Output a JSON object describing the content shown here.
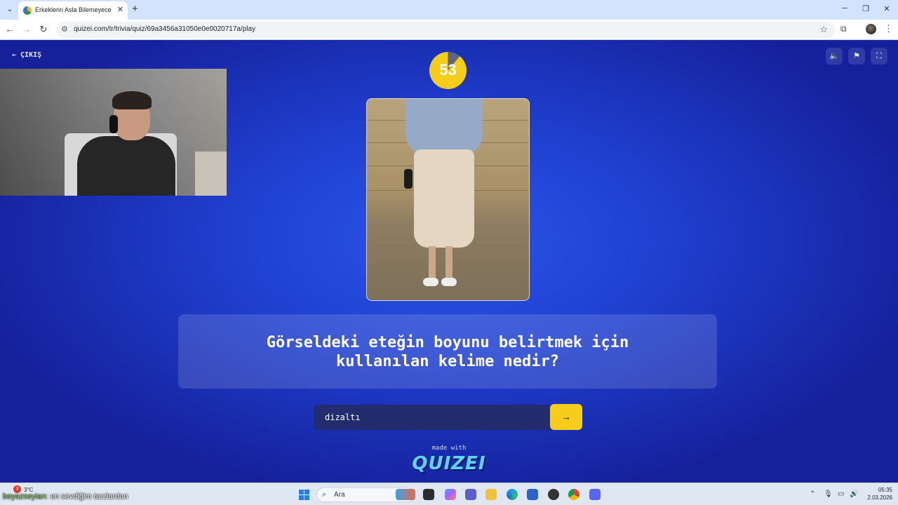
{
  "browser": {
    "tab_title": "Erkeklerin Asla Bilemeyeceği Şe",
    "url": "quizei.com/tr/trivia/quiz/69a3456a31050e0e0020717a/play"
  },
  "quiz": {
    "exit_label": "ÇIKIŞ",
    "timer": "53",
    "timer_remaining_fraction": 0.89,
    "question": "Görseldeki eteğin boyunu belirtmek için kullanılan kelime nedir?",
    "answer_value": "dizaltı",
    "submit_icon": "→",
    "made_with": "made with",
    "brand": "QUIZEI",
    "colors": {
      "accent": "#f5cd1a",
      "background": "#1f3fcf"
    }
  },
  "taskbar": {
    "weather_badge": "3",
    "weather_temp": "3°C",
    "ticker_user": "beyazseytan",
    "ticker_message": ": en sevdiğim tarzlardan",
    "search_label": "Ara",
    "time": "05:35",
    "date": "2.03.2026"
  },
  "icons": [
    "tab-list-icon",
    "close-icon",
    "plus-icon",
    "back-icon",
    "forward-icon",
    "reload-icon",
    "site-info-icon",
    "star-icon",
    "extensions-icon",
    "more-icon",
    "sound-icon",
    "flag-icon",
    "fullscreen-icon",
    "arrow-left-icon",
    "arrow-right-icon",
    "search-icon",
    "windows-icon"
  ]
}
